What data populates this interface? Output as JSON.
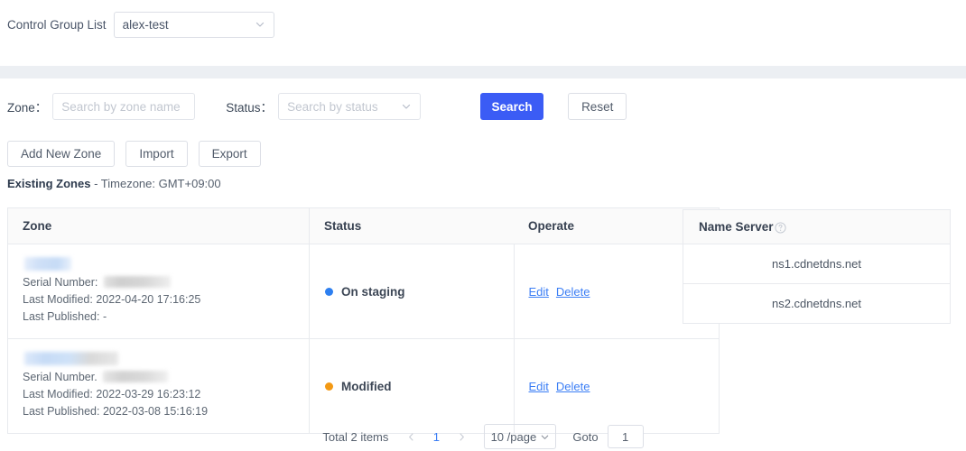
{
  "topbar": {
    "label": "Control Group List",
    "selected_group": "alex-test",
    "chevron_icon": "chevron-down-icon"
  },
  "filters": {
    "zone_label": "Zone：",
    "zone_placeholder": "Search by zone name",
    "zone_value": "",
    "status_label": "Status：",
    "status_placeholder": "Search by status",
    "status_value": "",
    "search_button": "Search",
    "reset_button": "Reset",
    "primary_color": "#3b5cf5"
  },
  "actions": {
    "add_new_zone": "Add New Zone",
    "import": "Import",
    "export": "Export"
  },
  "section": {
    "title": "Existing Zones",
    "separator": " - ",
    "timezone": "Timezone: GMT+09:00"
  },
  "table": {
    "columns": [
      "Zone",
      "Status",
      "Operate"
    ],
    "rows": [
      {
        "zone_name": "",
        "zone_name_redacted": true,
        "serial_label": "Serial Number:",
        "serial_value": "",
        "serial_redacted": true,
        "last_modified_label": "Last Modified:",
        "last_modified": "2022-04-20 17:16:25",
        "last_published_label": "Last Published:",
        "last_published": "-",
        "status": "On staging",
        "status_color": "#2d7ff0",
        "edit": "Edit",
        "delete": "Delete"
      },
      {
        "zone_name": "",
        "zone_name_redacted": true,
        "serial_label": "Serial Number.",
        "serial_value": "",
        "serial_redacted": true,
        "last_modified_label": "Last Modified:",
        "last_modified": "2022-03-29 16:23:12",
        "last_published_label": "Last Published:",
        "last_published": "2022-03-08 15:16:19",
        "status": "Modified",
        "status_color": "#f39914",
        "edit": "Edit",
        "delete": "Delete"
      }
    ]
  },
  "name_server": {
    "header": "Name Server",
    "help_icon": "question-circle-icon",
    "servers": [
      "ns1.cdnetdns.net",
      "ns2.cdnetdns.net"
    ]
  },
  "pagination": {
    "total_text": "Total 2 items",
    "prev_icon": "chevron-left-icon",
    "current_page": "1",
    "next_icon": "chevron-right-icon",
    "page_size": "10 /page",
    "page_size_icon": "chevron-down-icon",
    "goto_label": "Goto",
    "goto_value": "1"
  },
  "link_color": "#3b7ef5"
}
